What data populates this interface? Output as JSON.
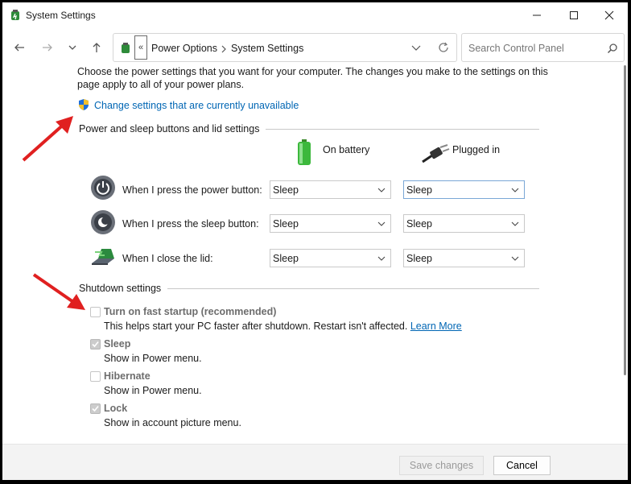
{
  "window": {
    "title": "System Settings"
  },
  "nav": {
    "breadcrumb_overflow": "«",
    "breadcrumbs": [
      "Power Options",
      "System Settings"
    ],
    "search_placeholder": "Search Control Panel"
  },
  "intro": {
    "text": "Choose the power settings that you want for your computer. The changes you make to the settings on this page apply to all of your power plans.",
    "change_link": "Change settings that are currently unavailable"
  },
  "power_section": {
    "heading": "Power and sleep buttons and lid settings",
    "col_battery": "On battery",
    "col_plugged": "Plugged in",
    "rows": [
      {
        "label": "When I press the power button:",
        "battery": "Sleep",
        "plugged": "Sleep"
      },
      {
        "label": "When I press the sleep button:",
        "battery": "Sleep",
        "plugged": "Sleep"
      },
      {
        "label": "When I close the lid:",
        "battery": "Sleep",
        "plugged": "Sleep"
      }
    ]
  },
  "shutdown_section": {
    "heading": "Shutdown settings",
    "items": [
      {
        "label": "Turn on fast startup (recommended)",
        "desc": "This helps start your PC faster after shutdown. Restart isn't affected.",
        "link": "Learn More",
        "checked": false
      },
      {
        "label": "Sleep",
        "desc": "Show in Power menu.",
        "checked": true
      },
      {
        "label": "Hibernate",
        "desc": "Show in Power menu.",
        "checked": false
      },
      {
        "label": "Lock",
        "desc": "Show in account picture menu.",
        "checked": true
      }
    ]
  },
  "footer": {
    "save_label": "Save changes",
    "cancel_label": "Cancel"
  },
  "colors": {
    "link": "#0066b4",
    "annotation_arrow": "#e02020",
    "disabled_text": "#9a9a9a"
  }
}
